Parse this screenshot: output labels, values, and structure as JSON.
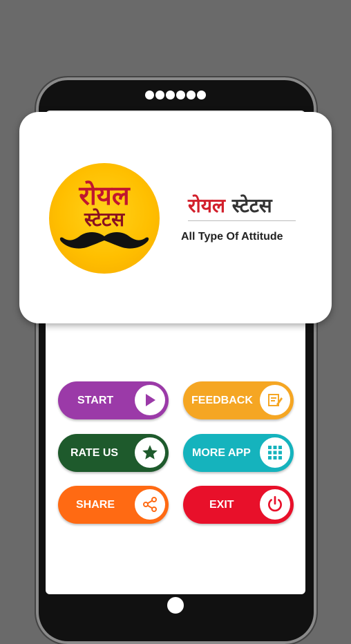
{
  "logo": {
    "line1": "रोयल",
    "line2": "स्टेटस"
  },
  "header": {
    "title_part1": "रोयल",
    "title_part2": "स्टेटस",
    "subtitle": "All Type Of Attitude"
  },
  "buttons": {
    "start": {
      "label": "START",
      "icon": "play-icon",
      "color": "#9b3aa8"
    },
    "feedback": {
      "label": "FEEDBACK",
      "icon": "feedback-icon",
      "color": "#f5a623"
    },
    "rate_us": {
      "label": "RATE US",
      "icon": "star-icon",
      "color": "#1e5a2c"
    },
    "more_app": {
      "label": "MORE APP",
      "icon": "grid-icon",
      "color": "#15b3bd"
    },
    "share": {
      "label": "SHARE",
      "icon": "share-icon",
      "color": "#ff6a13"
    },
    "exit": {
      "label": "EXIT",
      "icon": "power-icon",
      "color": "#e8102a"
    }
  },
  "colors": {
    "background": "#6a6a6a",
    "logo_yellow": "#ffbf00",
    "title_red": "#d21f2b"
  }
}
